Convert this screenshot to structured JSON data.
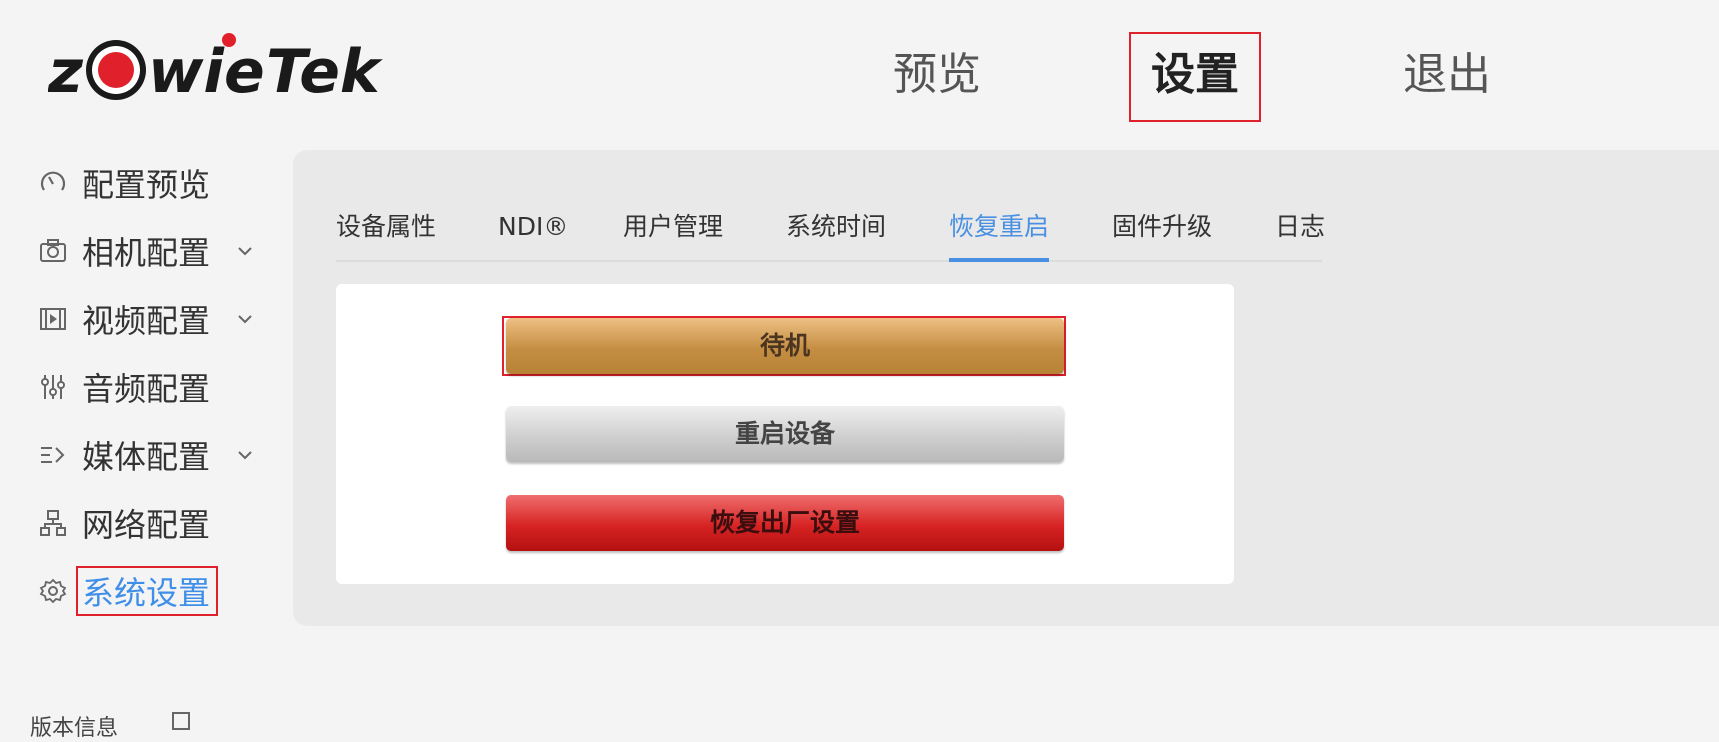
{
  "brand": {
    "logo_text_1": "z",
    "logo_text_2": "wie",
    "logo_text_3": "Tek",
    "accent": "#e0202a"
  },
  "header": {
    "nav": [
      {
        "label": "预览"
      },
      {
        "label": "设置",
        "active": true
      },
      {
        "label": "退出"
      }
    ]
  },
  "sidebar": {
    "items": [
      {
        "label": "配置预览",
        "icon": "gauge-icon"
      },
      {
        "label": "相机配置",
        "icon": "camera-icon",
        "expandable": true
      },
      {
        "label": "视频配置",
        "icon": "film-icon",
        "expandable": true
      },
      {
        "label": "音频配置",
        "icon": "mixer-sliders-icon"
      },
      {
        "label": "媒体配置",
        "icon": "media-list-icon",
        "expandable": true
      },
      {
        "label": "网络配置",
        "icon": "network-icon"
      },
      {
        "label": "系统设置",
        "icon": "gear-icon",
        "active": true
      }
    ]
  },
  "tabs": [
    {
      "label": "设备属性"
    },
    {
      "label": "NDI®"
    },
    {
      "label": "用户管理"
    },
    {
      "label": "系统时间"
    },
    {
      "label": "恢复重启",
      "active": true
    },
    {
      "label": "固件升级"
    },
    {
      "label": "日志"
    }
  ],
  "actions": {
    "standby": "待机",
    "reboot": "重启设备",
    "factory_reset": "恢复出厂设置"
  },
  "footer": {
    "version_label": "版本信息"
  },
  "colors": {
    "active_tab": "#4a90e2",
    "standby": "#c58e43",
    "factory": "#d72323"
  }
}
